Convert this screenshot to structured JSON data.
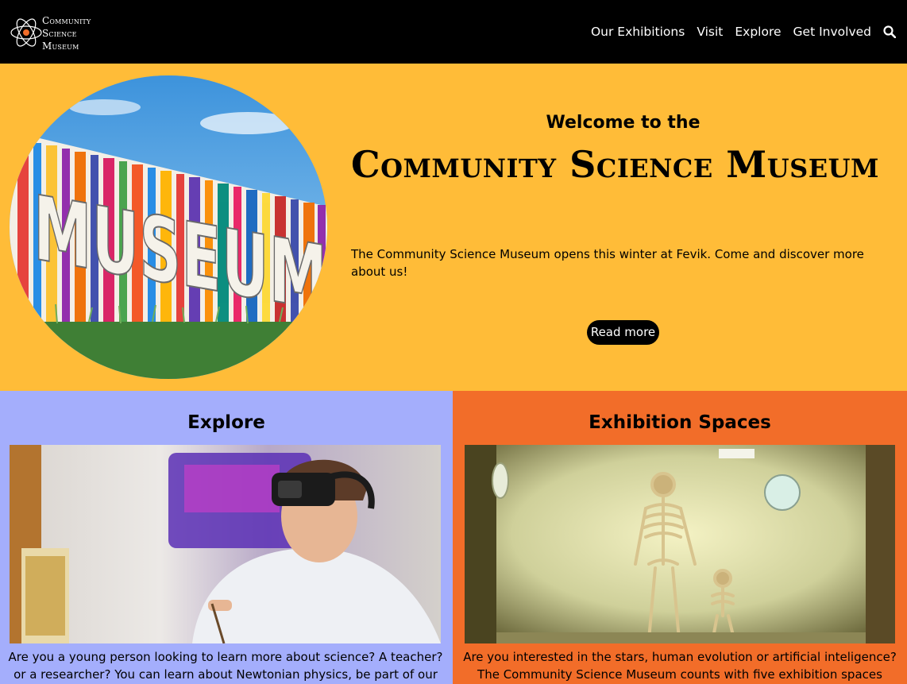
{
  "header": {
    "logo": {
      "line1": "Community",
      "line2": "Science",
      "line3": "Museum"
    },
    "nav": [
      {
        "label": "Our Exhibitions"
      },
      {
        "label": "Visit"
      },
      {
        "label": "Explore"
      },
      {
        "label": "Get Involved"
      }
    ],
    "search_icon": "search-icon"
  },
  "hero": {
    "welcome": "Welcome to the",
    "title": "Community Science Museum",
    "description": "The Community Science Museum opens this winter at Fevik. Come and discover more about us!",
    "button_label": "Read more",
    "image_text": "MUSEUM"
  },
  "cards": [
    {
      "title": "Explore",
      "text": "Are you a young person looking to learn more about science? A teacher? or a researcher? You can learn about Newtonian physics, be part of our"
    },
    {
      "title": "Exhibition Spaces",
      "text": "Are you interested in the stars, human evolution or artificial inteligence? The Community Science Museum counts with five exhibition spaces"
    }
  ],
  "colors": {
    "header_bg": "#000000",
    "hero_bg": "#ffbc38",
    "explore_bg": "#a4aefc",
    "exhibition_bg": "#f26d29",
    "button_bg": "#000000"
  }
}
